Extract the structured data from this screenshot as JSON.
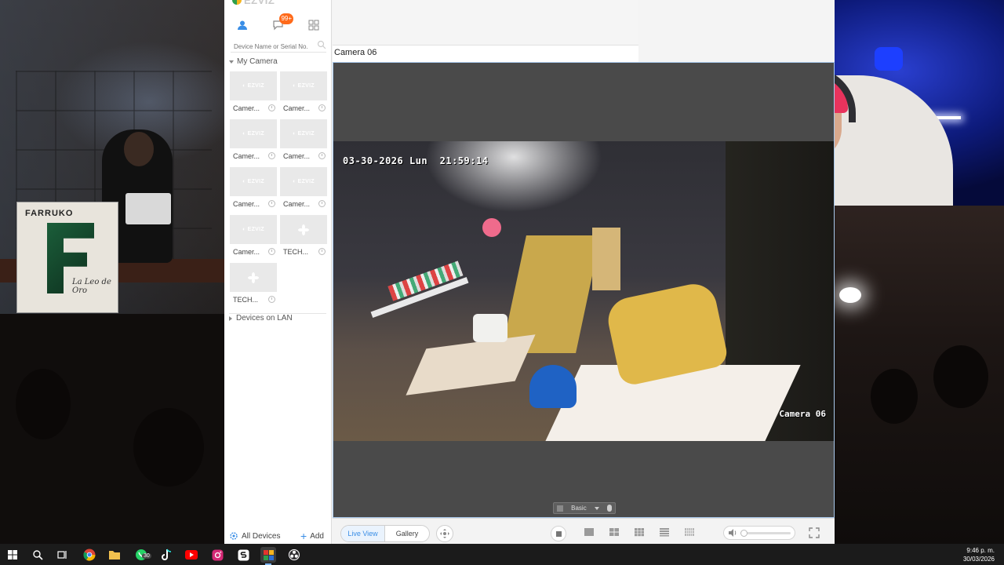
{
  "app": {
    "brand": "EZVIZ",
    "notification_badge": "99+",
    "search_placeholder": "Device Name or Serial No.",
    "group_my_camera": "My Camera",
    "cameras": [
      {
        "label": "Camer...",
        "thumb": "ezviz-logo"
      },
      {
        "label": "Camer...",
        "thumb": "ezviz-logo"
      },
      {
        "label": "Camer...",
        "thumb": "ezviz-logo"
      },
      {
        "label": "Camer...",
        "thumb": "ezviz-logo"
      },
      {
        "label": "Camer...",
        "thumb": "ezviz-logo"
      },
      {
        "label": "Camer...",
        "thumb": "ezviz-logo"
      },
      {
        "label": "Camer...",
        "thumb": "ezviz-logo"
      },
      {
        "label": "TECH...",
        "thumb": "fan-icon"
      },
      {
        "label": "TECH...",
        "thumb": "fan-icon"
      }
    ],
    "group_lan": "Devices on LAN",
    "all_devices": "All Devices",
    "add": "Add",
    "view_title": "Camera 06",
    "osd_date": "03-30-2026",
    "osd_day": "Lun",
    "osd_time": "21:59:14",
    "osd_camera_name": "Camera 06",
    "quality_label": "Basic",
    "tab_live_view": "Live View",
    "tab_gallery": "Gallery"
  },
  "taskbar": {
    "whatsapp_badge": "30",
    "time": "9:46 p. m.",
    "date": "30/03/2026"
  },
  "scene": {
    "poster_title": "FARRUKO",
    "poster_script": "La Leo de Oro"
  },
  "colors": {
    "accent": "#3a8ee6",
    "badge": "#ff6a1a",
    "taskbar": "#1b1b1b"
  }
}
